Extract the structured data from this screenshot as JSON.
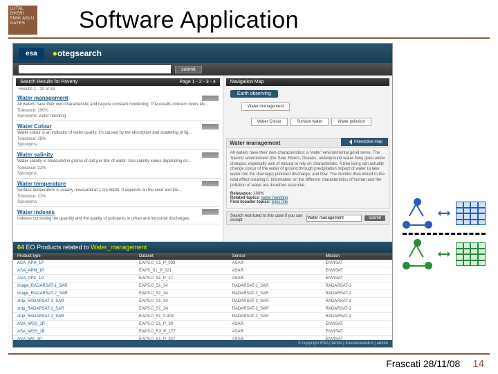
{
  "slide": {
    "title": "Software Application",
    "logo_text": "LUTAL OVERI SNNI AKLU GATES",
    "footer_location": "Frascati 28/11/08",
    "page_number": "14"
  },
  "app": {
    "brand_esa": "esa",
    "brand_search": "otegsearch",
    "submit": "submit",
    "searchbar_label": "",
    "results_header_left": "Search Results for Poverty",
    "results_header_meta": "Results 1 - 10 of 33",
    "results_pager": "Page  1 - 2 - 3 - 4",
    "nav_map_title": "Navigation Map",
    "nav_root": "Earth observing",
    "nav_chip1": "Water management",
    "nav_sub": [
      "Water Colour",
      "Surface water",
      "Water pollution"
    ],
    "interactive_map": "Interactive map",
    "products_count": "64",
    "products_label": "EO Products related to",
    "products_topic": "Water_management",
    "footer": "© copyright ESA  |  terms  |  freelanceweb.it  |  admin"
  },
  "results": [
    {
      "title": "Water management",
      "desc": "All waters have their own characteristic and require constant monitoring. The results concern rivers etc...",
      "meta1": "Tolerance: 100%",
      "meta2": "Synonyms: water handling"
    },
    {
      "title": "Water Colour",
      "desc": "Water colour is an indicator of water quality. It's caused by the absorption and scattering of lig...",
      "meta1": "Tolerance: 25%",
      "meta2": "Synonyms:"
    },
    {
      "title": "Water salinity",
      "desc": "Water salinity is measured in grams of salt per liter of water. Sea salinity varies depending on...",
      "meta1": "Tolerance: 21%",
      "meta2": "Synonyms:"
    },
    {
      "title": "Water temperature",
      "desc": "Surface temperature is usually measured at 1 cm depth. It depends on the wind and the...",
      "meta1": "Tolerance: 21%",
      "meta2": "Synonyms:"
    },
    {
      "title": "Water indexes",
      "desc": "Indexes consisting the quantity and the quality of pollutants in urban and industrial discharges.",
      "meta1": "",
      "meta2": ""
    }
  ],
  "detail": {
    "title": "Water management",
    "body": "All waters have their own characteristics; a 'water' environmental good serve. The 'friends' environment (the Sow, Rivers, Oceans, underground water flow) goes under changes, especially lack of natural to rely on characteristic. A tree living can actually change colour of the water of ground through precipitation impact of water (a lake water into the drainage) pollutant discharge, and flow. The monitor then linked to the total effect creating it.\nInformation on the different characteristics of human and the pollution of water are therefore essential.",
    "relevance_label": "Relevance:",
    "relevance_value": "100%",
    "related_label": "Related topics:",
    "related_links": "water handling",
    "broader_label": "Find broader topics:",
    "broader_links": "topic title",
    "filter_prompt": "Search restricted to this case if you can accept",
    "filter_value": "Water management",
    "filter_btn": "submit"
  },
  "table": {
    "headers": [
      "Product type",
      "Dataset",
      "Sensor",
      "Mission"
    ],
    "rows": [
      [
        "ASA_APH_1P",
        "EAPS.0_S1_P_039",
        "ASAR",
        "ENVISAT"
      ],
      [
        "ASA_APM_1P",
        "EAPS_S1_P_021",
        "ASAR",
        "ENVISAT"
      ],
      [
        "ASA_APC_1P",
        "EAPS.0_S1_P_17",
        "ASAR",
        "ENVISAT"
      ],
      [
        "image_RADARSAT-1_SAR",
        "EAPS.0_S1_34",
        "RADARSAT-1_SAR",
        "RADARSAT-1"
      ],
      [
        "image_RADARSAT-2_SAR",
        "EAPS.0_S1_34",
        "RADARSAT-2_SAR",
        "RADARSAT-2"
      ],
      [
        "strip_RADARSAT-2_SAR",
        "EAPS.0_S1_34",
        "RADARSAT-2_SAR",
        "RADARSAT-2"
      ],
      [
        "strip_RADARSAT-2_SAR",
        "EAPS.0_S1_34",
        "RADARSAT-2_SAR",
        "RADARSAT-2"
      ],
      [
        "strip_RADARSAT-2_SAR",
        "EAPS.0_S1_0.003",
        "RADARSAT-2_SAR",
        "RADARSAT-2"
      ],
      [
        "ASA_WSS_1P",
        "EAPS.0_S1_P_30",
        "ASAR",
        "ENVISAT"
      ],
      [
        "ASA_WSS_1P",
        "EAPS.0_R3_P_177",
        "ASAR",
        "ENVISAT"
      ],
      [
        "ASA_WS_1P",
        "EAPS.0_S1_P_337",
        "ASAR",
        "ENVISAT"
      ]
    ]
  }
}
